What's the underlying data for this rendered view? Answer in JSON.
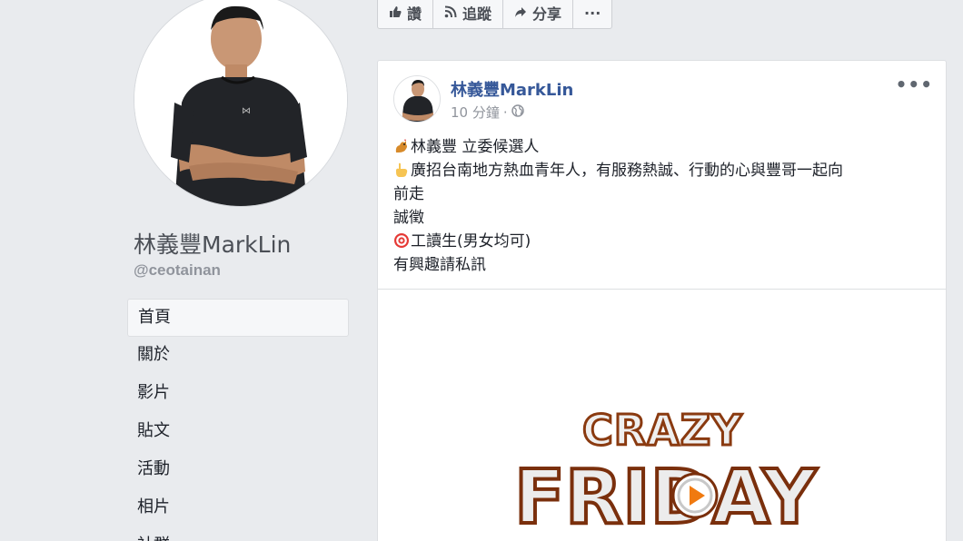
{
  "page": {
    "name": "林義豐MarkLin",
    "handle": "@ceotainan"
  },
  "nav": {
    "items": [
      {
        "label": "首頁",
        "active": true
      },
      {
        "label": "關於"
      },
      {
        "label": "影片"
      },
      {
        "label": "貼文"
      },
      {
        "label": "活動"
      },
      {
        "label": "相片"
      },
      {
        "label": "社群"
      }
    ]
  },
  "toolbar": {
    "like_label": "讚",
    "follow_label": "追蹤",
    "share_label": "分享",
    "more_label": "···"
  },
  "post": {
    "author": "林義豐MarkLin",
    "time": "10 分鐘",
    "meta_separator": "·",
    "more": "•••",
    "lines": [
      "林義豐 立委候選人",
      "廣招台南地方熱血青年人，有服務熱誠、行動的心與豐哥一起向",
      "前走",
      "誠徵",
      "工讀生(男女均可)",
      "有興趣請私訊"
    ],
    "line_emojis": [
      "rooster",
      "pointing-hand",
      "",
      "",
      "target",
      ""
    ],
    "image": {
      "title_top": "CRAZY",
      "title_bottom": "FRIDAY"
    }
  },
  "colors": {
    "link": "#365899",
    "background": "#e9ebee",
    "accent_orange": "#f07a10"
  }
}
